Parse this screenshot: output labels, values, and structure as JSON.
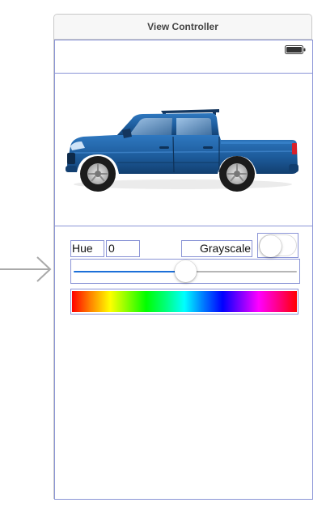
{
  "scene": {
    "title": "View Controller"
  },
  "controls": {
    "hue_label": "Hue",
    "hue_value": "0",
    "grayscale_label": "Grayscale",
    "grayscale_on": false
  },
  "slider": {
    "value": 0.5
  },
  "icons": {
    "entry_arrow": "arrow-right-icon",
    "battery": "battery-icon",
    "truck_image": "truck-image"
  },
  "colors": {
    "selection_outline": "#8a94d6",
    "slider_min_track": "#1c6fd8",
    "truck_body": "#1d5c9c"
  }
}
